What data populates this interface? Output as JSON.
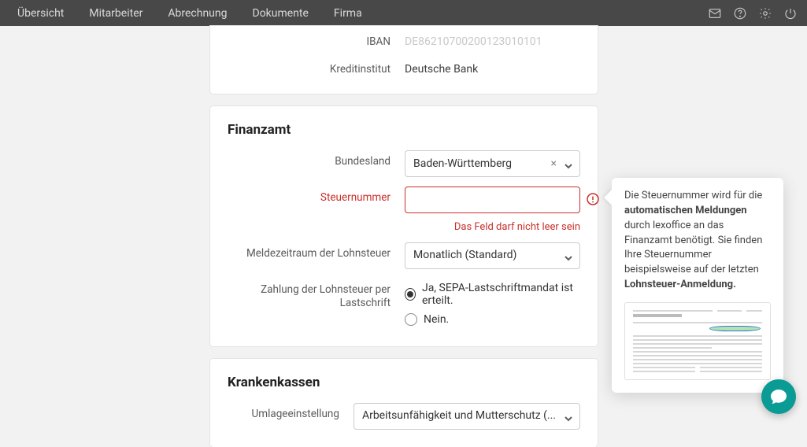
{
  "nav": {
    "items": [
      "Übersicht",
      "Mitarbeiter",
      "Abrechnung",
      "Dokumente",
      "Firma"
    ]
  },
  "bank": {
    "iban_label": "IBAN",
    "iban_value": "DE86210700200123010101",
    "inst_label": "Kreditinstitut",
    "inst_value": "Deutsche Bank"
  },
  "finanzamt": {
    "title": "Finanzamt",
    "bundesland_label": "Bundesland",
    "bundesland_value": "Baden-Württemberg",
    "steuernummer_label": "Steuernummer",
    "steuernummer_value": "",
    "steuernummer_error": "Das Feld darf nicht leer sein",
    "meldezeitraum_label": "Meldezeitraum der Lohnsteuer",
    "meldezeitraum_value": "Monatlich (Standard)",
    "lastschrift_label": "Zahlung der Lohnsteuer per Lastschrift",
    "radio_yes": "Ja, SEPA-Lastschriftmandat ist erteilt.",
    "radio_no": "Nein."
  },
  "krankenkassen": {
    "title": "Krankenkassen",
    "umlage_label": "Umlageeinstellung",
    "umlage_value": "Arbeitsunfähigkeit und Mutterschutz (..."
  },
  "tooltip": {
    "t1": "Die Steuernummer wird für die ",
    "t2": "automatischen Meldungen",
    "t3": " durch lexoffice an das Finanzamt benötigt. Sie finden Ihre Steuernummer beispielsweise auf der letzten ",
    "t4": "Lohnsteuer-Anmeldung."
  }
}
